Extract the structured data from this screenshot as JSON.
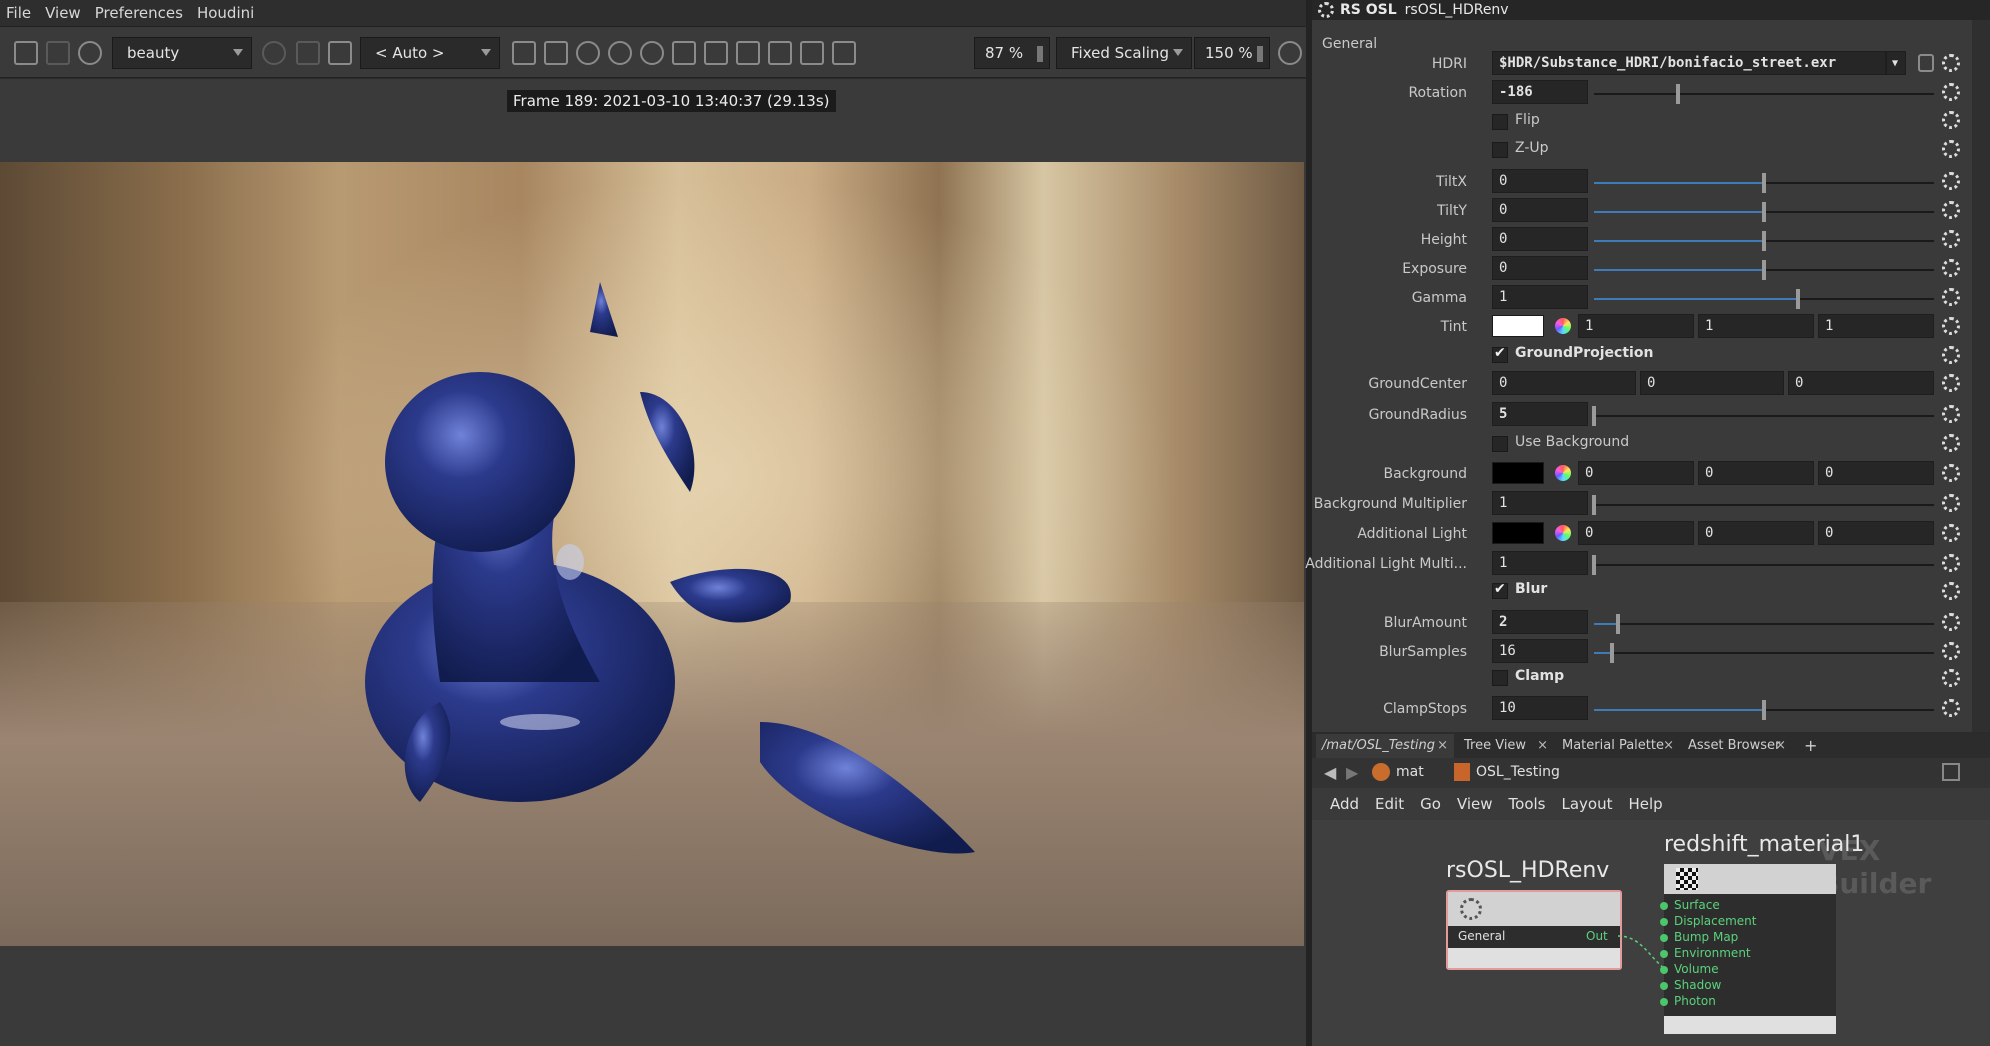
{
  "menu": [
    "File",
    "View",
    "Preferences",
    "Houdini"
  ],
  "viewer": {
    "aov": "beauty",
    "camera": "< Auto >",
    "zoom": "87 %",
    "scaling_mode": "Fixed Scaling",
    "scaling_pct": "150 %",
    "frame_info": "Frame 189:  2021-03-10  13:40:37  (29.13s)"
  },
  "params_header": {
    "node_type": "RS OSL",
    "node_name": "rsOSL_HDRenv"
  },
  "params": {
    "folder": "General",
    "hdri_label": "HDRI",
    "hdri_value": "$HDR/Substance_HDRI/bonifacio_street.exr",
    "rotation_label": "Rotation",
    "rotation_value": "-186",
    "flip_label": "Flip",
    "zup_label": "Z-Up",
    "tiltx_label": "TiltX",
    "tiltx_value": "0",
    "tilty_label": "TiltY",
    "tilty_value": "0",
    "height_label": "Height",
    "height_value": "0",
    "exposure_label": "Exposure",
    "exposure_value": "0",
    "gamma_label": "Gamma",
    "gamma_value": "1",
    "tint_label": "Tint",
    "tint_r": "1",
    "tint_g": "1",
    "tint_b": "1",
    "groundproj_label": "GroundProjection",
    "groundcenter_label": "GroundCenter",
    "groundcenter_x": "0",
    "groundcenter_y": "0",
    "groundcenter_z": "0",
    "groundradius_label": "GroundRadius",
    "groundradius_value": "5",
    "usebg_label": "Use Background",
    "background_label": "Background",
    "background_r": "0",
    "background_g": "0",
    "background_b": "0",
    "bgmult_label": "Background Multiplier",
    "bgmult_value": "1",
    "addlight_label": "Additional Light",
    "addlight_r": "0",
    "addlight_g": "0",
    "addlight_b": "0",
    "addlightmult_label": "Additional Light Multi...",
    "addlightmult_value": "1",
    "blur_label": "Blur",
    "bluramount_label": "BlurAmount",
    "bluramount_value": "2",
    "blursamples_label": "BlurSamples",
    "blursamples_value": "16",
    "clamp_label": "Clamp",
    "clampstops_label": "ClampStops",
    "clampstops_value": "10"
  },
  "network": {
    "tabs": [
      "/mat/OSL_Testing",
      "Tree View",
      "Material Palette",
      "Asset Browser"
    ],
    "path": [
      "mat",
      "OSL_Testing"
    ],
    "menu": [
      "Add",
      "Edit",
      "Go",
      "View",
      "Tools",
      "Layout",
      "Help"
    ],
    "watermark": "VEX Builder",
    "node1": {
      "name": "rsOSL_HDRenv",
      "input": "General",
      "output": "Out"
    },
    "node2": {
      "name": "redshift_material1",
      "ports": [
        "Surface",
        "Displacement",
        "Bump Map",
        "Environment",
        "Volume",
        "Shadow",
        "Photon"
      ]
    }
  }
}
